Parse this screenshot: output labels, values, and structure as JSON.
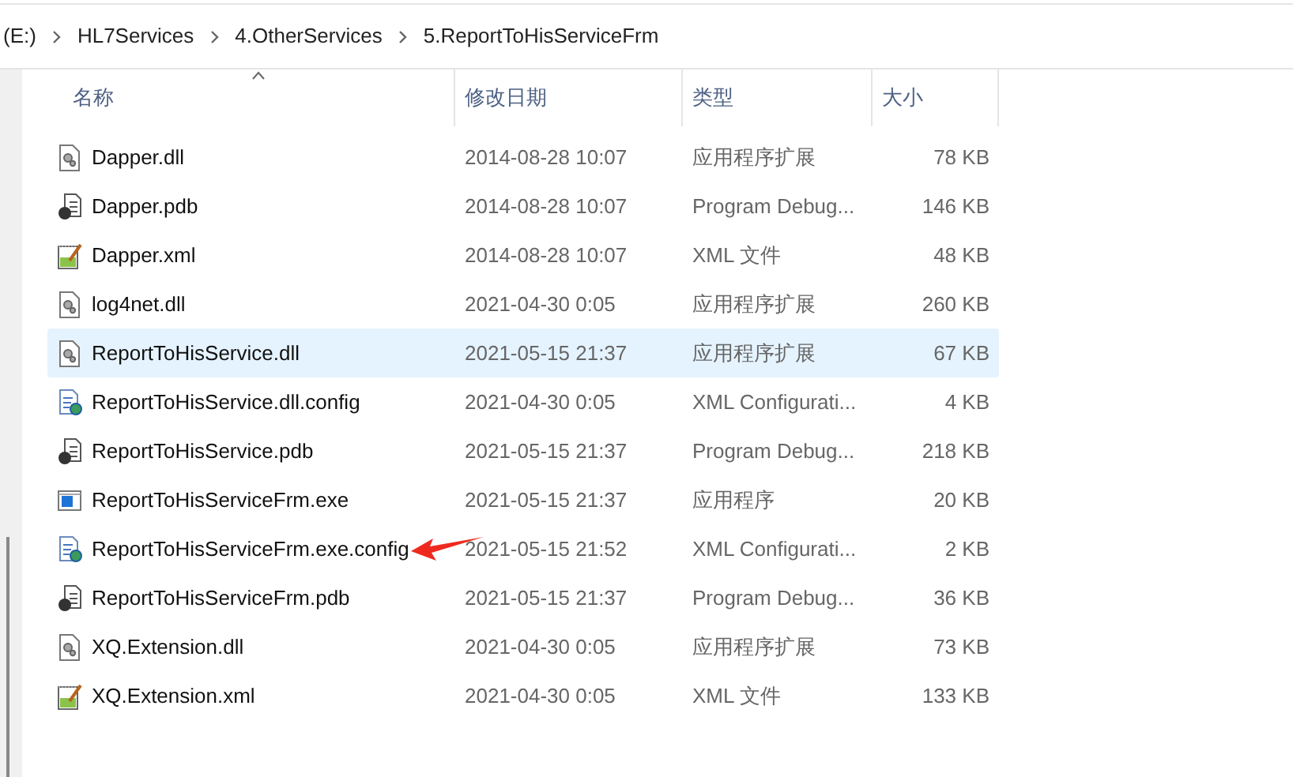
{
  "breadcrumb": [
    "(E:)",
    "HL7Services",
    "4.OtherServices",
    "5.ReportToHisServiceFrm"
  ],
  "columns": [
    {
      "label": "名称",
      "sorted": true
    },
    {
      "label": "修改日期",
      "sorted": false
    },
    {
      "label": "类型",
      "sorted": false
    },
    {
      "label": "大小",
      "sorted": false
    }
  ],
  "rows": [
    {
      "kind": "dll",
      "name": "Dapper.dll",
      "date": "2014-08-28 10:07",
      "type": "应用程序扩展",
      "size": "78 KB",
      "selected": false
    },
    {
      "kind": "pdb",
      "name": "Dapper.pdb",
      "date": "2014-08-28 10:07",
      "type": "Program Debug...",
      "size": "146 KB",
      "selected": false
    },
    {
      "kind": "xml",
      "name": "Dapper.xml",
      "date": "2014-08-28 10:07",
      "type": "XML 文件",
      "size": "48 KB",
      "selected": false
    },
    {
      "kind": "dll",
      "name": "log4net.dll",
      "date": "2021-04-30 0:05",
      "type": "应用程序扩展",
      "size": "260 KB",
      "selected": false
    },
    {
      "kind": "dll",
      "name": "ReportToHisService.dll",
      "date": "2021-05-15 21:37",
      "type": "应用程序扩展",
      "size": "67 KB",
      "selected": true
    },
    {
      "kind": "config",
      "name": "ReportToHisService.dll.config",
      "date": "2021-04-30 0:05",
      "type": "XML Configurati...",
      "size": "4 KB",
      "selected": false
    },
    {
      "kind": "pdb",
      "name": "ReportToHisService.pdb",
      "date": "2021-05-15 21:37",
      "type": "Program Debug...",
      "size": "218 KB",
      "selected": false
    },
    {
      "kind": "exe",
      "name": "ReportToHisServiceFrm.exe",
      "date": "2021-05-15 21:37",
      "type": "应用程序",
      "size": "20 KB",
      "selected": false
    },
    {
      "kind": "config",
      "name": "ReportToHisServiceFrm.exe.config",
      "date": "2021-05-15 21:52",
      "type": "XML Configurati...",
      "size": "2 KB",
      "selected": false
    },
    {
      "kind": "pdb",
      "name": "ReportToHisServiceFrm.pdb",
      "date": "2021-05-15 21:37",
      "type": "Program Debug...",
      "size": "36 KB",
      "selected": false
    },
    {
      "kind": "dll",
      "name": "XQ.Extension.dll",
      "date": "2021-04-30 0:05",
      "type": "应用程序扩展",
      "size": "73 KB",
      "selected": false
    },
    {
      "kind": "xml",
      "name": "XQ.Extension.xml",
      "date": "2021-04-30 0:05",
      "type": "XML 文件",
      "size": "133 KB",
      "selected": false
    }
  ]
}
